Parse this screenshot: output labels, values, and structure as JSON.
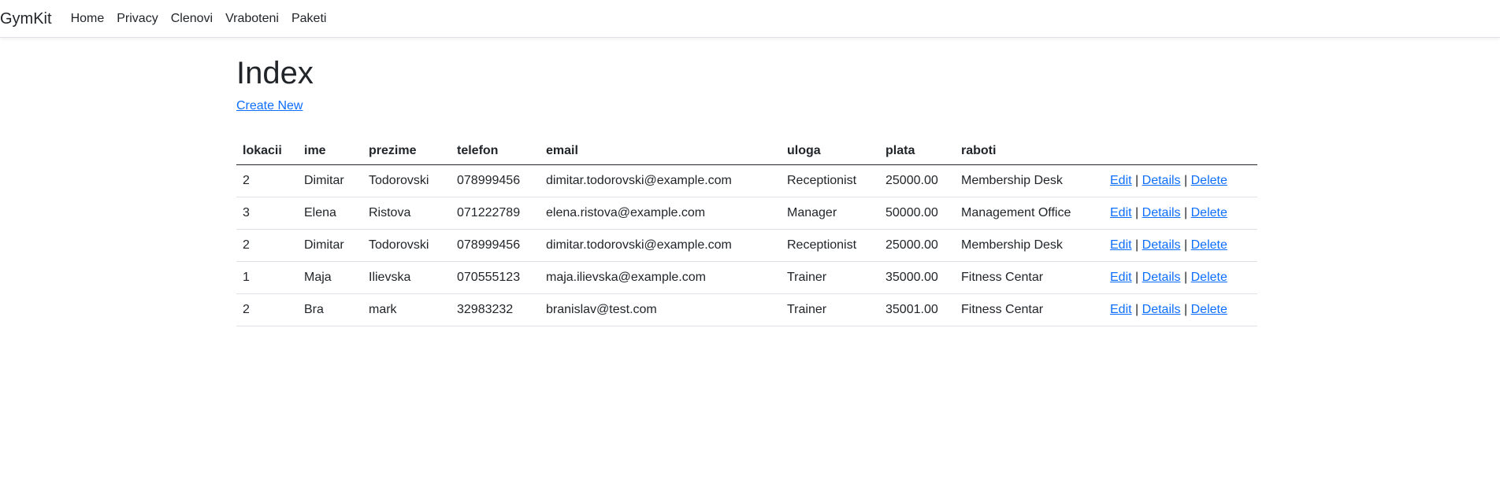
{
  "navbar": {
    "brand": "GymKit",
    "links": [
      "Home",
      "Privacy",
      "Clenovi",
      "Vraboteni",
      "Paketi"
    ]
  },
  "page": {
    "title": "Index",
    "create_new": "Create New"
  },
  "table": {
    "headers": [
      "lokacii",
      "ime",
      "prezime",
      "telefon",
      "email",
      "uloga",
      "plata",
      "raboti",
      ""
    ],
    "rows": [
      {
        "lokacii": "2",
        "ime": "Dimitar",
        "prezime": "Todorovski",
        "telefon": "078999456",
        "email": "dimitar.todorovski@example.com",
        "uloga": "Receptionist",
        "plata": "25000.00",
        "raboti": "Membership Desk"
      },
      {
        "lokacii": "3",
        "ime": "Elena",
        "prezime": "Ristova",
        "telefon": "071222789",
        "email": "elena.ristova@example.com",
        "uloga": "Manager",
        "plata": "50000.00",
        "raboti": "Management Office"
      },
      {
        "lokacii": "2",
        "ime": "Dimitar",
        "prezime": "Todorovski",
        "telefon": "078999456",
        "email": "dimitar.todorovski@example.com",
        "uloga": "Receptionist",
        "plata": "25000.00",
        "raboti": "Membership Desk"
      },
      {
        "lokacii": "1",
        "ime": "Maja",
        "prezime": "Ilievska",
        "telefon": "070555123",
        "email": "maja.ilievska@example.com",
        "uloga": "Trainer",
        "plata": "35000.00",
        "raboti": "Fitness Centar"
      },
      {
        "lokacii": "2",
        "ime": "Bra",
        "prezime": "mark",
        "telefon": "32983232",
        "email": "branislav@test.com",
        "uloga": "Trainer",
        "plata": "35001.00",
        "raboti": "Fitness Centar"
      }
    ],
    "actions": {
      "edit": "Edit",
      "details": "Details",
      "delete": "Delete",
      "separator": "|"
    }
  },
  "colors": {
    "link": "#0d6efd",
    "text": "#212529",
    "border": "#dee2e6"
  }
}
